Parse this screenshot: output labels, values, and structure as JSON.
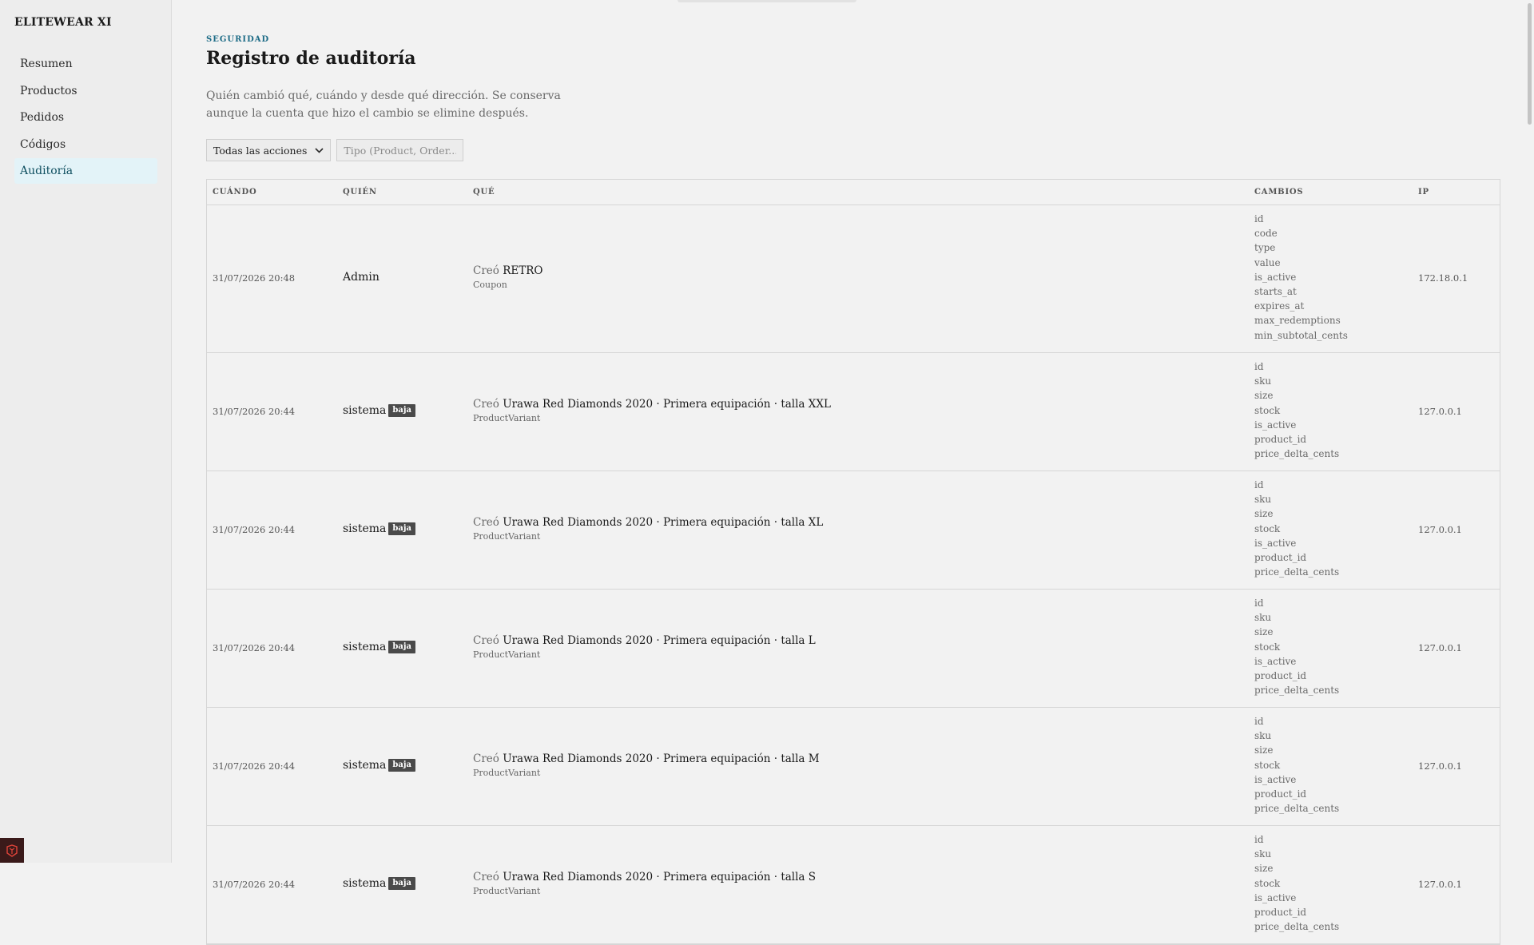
{
  "app": {
    "brand": "ELITEWEAR XI"
  },
  "sidebar": {
    "items": [
      {
        "label": "Resumen",
        "active": false
      },
      {
        "label": "Productos",
        "active": false
      },
      {
        "label": "Pedidos",
        "active": false
      },
      {
        "label": "Códigos",
        "active": false
      },
      {
        "label": "Auditoría",
        "active": true
      }
    ]
  },
  "page": {
    "eyebrow": "SEGURIDAD",
    "title": "Registro de auditoría",
    "description": "Quién cambió qué, cuándo y desde qué dirección. Se conserva aunque la cuenta que hizo el cambio se elimine después."
  },
  "filters": {
    "action_select": "Todas las acciones",
    "type_placeholder": "Tipo (Product, Order...)"
  },
  "table": {
    "columns": {
      "when": "CUÁNDO",
      "who": "QUIÉN",
      "what": "QUÉ",
      "changes": "CAMBIOS",
      "ip": "IP"
    },
    "rows": [
      {
        "when": "31/07/2026 20:48",
        "who": "Admin",
        "badge": "",
        "verb": "Creó",
        "subject": "RETRO",
        "type": "Coupon",
        "changes": [
          "id",
          "code",
          "type",
          "value",
          "is_active",
          "starts_at",
          "expires_at",
          "max_redemptions",
          "min_subtotal_cents"
        ],
        "ip": "172.18.0.1"
      },
      {
        "when": "31/07/2026 20:44",
        "who": "sistema",
        "badge": "baja",
        "verb": "Creó",
        "subject": "Urawa Red Diamonds 2020 · Primera equipación · talla XXL",
        "type": "ProductVariant",
        "changes": [
          "id",
          "sku",
          "size",
          "stock",
          "is_active",
          "product_id",
          "price_delta_cents"
        ],
        "ip": "127.0.0.1"
      },
      {
        "when": "31/07/2026 20:44",
        "who": "sistema",
        "badge": "baja",
        "verb": "Creó",
        "subject": "Urawa Red Diamonds 2020 · Primera equipación · talla XL",
        "type": "ProductVariant",
        "changes": [
          "id",
          "sku",
          "size",
          "stock",
          "is_active",
          "product_id",
          "price_delta_cents"
        ],
        "ip": "127.0.0.1"
      },
      {
        "when": "31/07/2026 20:44",
        "who": "sistema",
        "badge": "baja",
        "verb": "Creó",
        "subject": "Urawa Red Diamonds 2020 · Primera equipación · talla L",
        "type": "ProductVariant",
        "changes": [
          "id",
          "sku",
          "size",
          "stock",
          "is_active",
          "product_id",
          "price_delta_cents"
        ],
        "ip": "127.0.0.1"
      },
      {
        "when": "31/07/2026 20:44",
        "who": "sistema",
        "badge": "baja",
        "verb": "Creó",
        "subject": "Urawa Red Diamonds 2020 · Primera equipación · talla M",
        "type": "ProductVariant",
        "changes": [
          "id",
          "sku",
          "size",
          "stock",
          "is_active",
          "product_id",
          "price_delta_cents"
        ],
        "ip": "127.0.0.1"
      },
      {
        "when": "31/07/2026 20:44",
        "who": "sistema",
        "badge": "baja",
        "verb": "Creó",
        "subject": "Urawa Red Diamonds 2020 · Primera equipación · talla S",
        "type": "ProductVariant",
        "changes": [
          "id",
          "sku",
          "size",
          "stock",
          "is_active",
          "product_id",
          "price_delta_cents"
        ],
        "ip": "127.0.0.1"
      }
    ]
  },
  "colors": {
    "accent": "#1c6b86",
    "active_nav_bg": "#e3f3f8",
    "badge_bg": "#4a4a4a"
  }
}
